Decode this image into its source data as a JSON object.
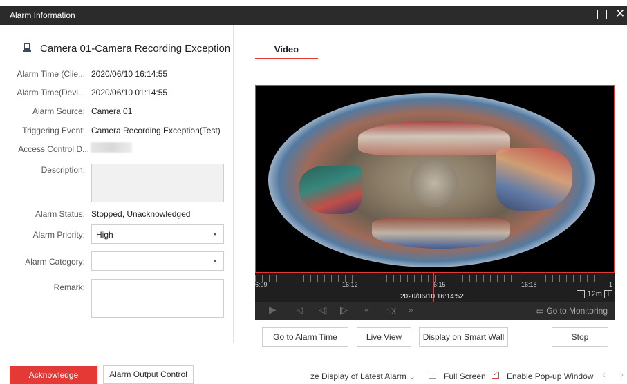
{
  "window": {
    "title": "Alarm Information"
  },
  "header": {
    "title": "Camera 01-Camera Recording Exception"
  },
  "fields": {
    "alarm_time_client_label": "Alarm Time (Clie...",
    "alarm_time_client_value": "2020/06/10 16:14:55",
    "alarm_time_device_label": "Alarm Time(Devi...",
    "alarm_time_device_value": "2020/06/10 01:14:55",
    "alarm_source_label": "Alarm Source:",
    "alarm_source_value": "Camera 01",
    "triggering_event_label": "Triggering Event:",
    "triggering_event_value": "Camera Recording Exception(Test)",
    "access_control_label": "Access Control D...",
    "description_label": "Description:",
    "alarm_status_label": "Alarm Status:",
    "alarm_status_value": "Stopped, Unacknowledged",
    "alarm_priority_label": "Alarm Priority:",
    "alarm_priority_value": "High",
    "alarm_category_label": "Alarm Category:",
    "alarm_category_value": "",
    "remark_label": "Remark:"
  },
  "video": {
    "tab_label": "Video",
    "tick_labels": [
      "6:09",
      "16:12",
      "6:15",
      "16:18",
      "1"
    ],
    "timestamp": "2020/06/10 16:14:52",
    "zoom_minus": "−",
    "zoom_level": "12m",
    "zoom_plus": "+",
    "speed": "1X",
    "go_to_monitoring": "Go to Monitoring"
  },
  "actions": {
    "go_to_alarm_time": "Go to Alarm Time",
    "live_view": "Live View",
    "display_on_smart_wall": "Display on Smart Wall",
    "stop": "Stop"
  },
  "bottom": {
    "acknowledge": "Acknowledge",
    "alarm_output_control": "Alarm Output Control",
    "display_latest": "ze Display of Latest Alarm",
    "full_screen": "Full Screen",
    "full_screen_checked": false,
    "enable_popup": "Enable Pop-up Window",
    "enable_popup_checked": true
  },
  "colors": {
    "accent": "#e53935",
    "titlebar": "#2b2b2b"
  }
}
